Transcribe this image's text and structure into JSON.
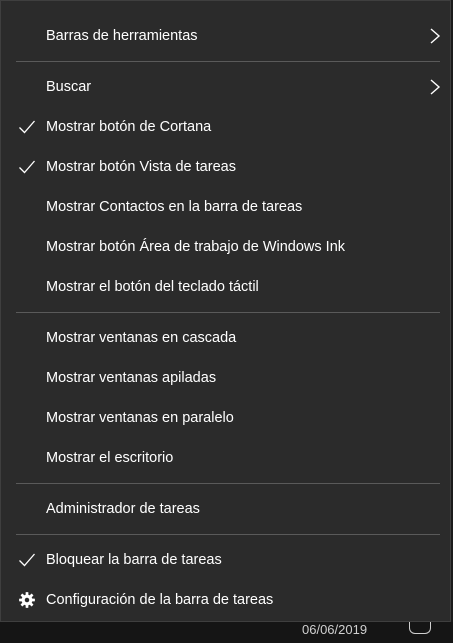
{
  "menu": {
    "toolbars": {
      "label": "Barras de herramientas",
      "icon": "chevron-right-icon"
    },
    "search": {
      "label": "Buscar",
      "icon": "chevron-right-icon"
    },
    "cortana": {
      "label": "Mostrar botón de Cortana",
      "checked": true
    },
    "task_view": {
      "label": "Mostrar botón Vista de tareas",
      "checked": true
    },
    "contacts": {
      "label": "Mostrar Contactos en la barra de tareas",
      "checked": false
    },
    "ink": {
      "label": "Mostrar botón Área de trabajo de Windows Ink",
      "checked": false
    },
    "touch_keyboard": {
      "label": "Mostrar el botón del teclado táctil",
      "checked": false
    },
    "cascade": {
      "label": "Mostrar ventanas en cascada"
    },
    "stacked": {
      "label": "Mostrar ventanas apiladas"
    },
    "side_by_side": {
      "label": "Mostrar ventanas en paralelo"
    },
    "desktop": {
      "label": "Mostrar el escritorio"
    },
    "task_manager": {
      "label": "Administrador de tareas"
    },
    "lock_taskbar": {
      "label": "Bloquear la barra de tareas",
      "checked": true
    },
    "settings": {
      "label": "Configuración de la barra de tareas",
      "icon": "gear-icon"
    }
  },
  "taskbar": {
    "date": "06/06/2019",
    "notification_icon": "action-center-icon"
  },
  "colors": {
    "menu_background": "#2b2b2b",
    "text": "#ffffff",
    "separator": "#5a5a5a"
  }
}
